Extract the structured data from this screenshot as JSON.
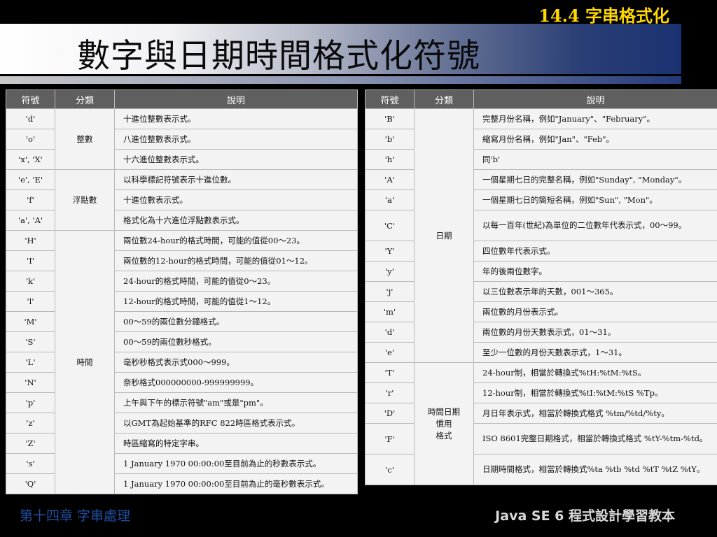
{
  "section": "14.4 字串格式化",
  "title": "數字與日期時間格式化符號",
  "left_table": {
    "headers": [
      "符號",
      "分類",
      "說明"
    ],
    "groups": [
      "整數",
      "浮點數",
      "時間"
    ],
    "rows": [
      {
        "sym": "'d'",
        "desc": "十進位整數表示式。"
      },
      {
        "sym": "'o'",
        "desc": "八進位整數表示式。"
      },
      {
        "sym": "'x', 'X'",
        "desc": "十六進位整數表示式。"
      },
      {
        "sym": "'e', 'E'",
        "desc": "以科學標記符號表示十進位數。"
      },
      {
        "sym": "'f'",
        "desc": "十進位數表示式。"
      },
      {
        "sym": "'a', 'A'",
        "desc": "格式化為十六進位浮點數表示式。"
      },
      {
        "sym": "'H'",
        "desc": "兩位數24-hour的格式時間，可能的值從00～23。"
      },
      {
        "sym": "'I'",
        "desc": "兩位數的12-hour的格式時間，可能的值從01～12。"
      },
      {
        "sym": "'k'",
        "desc": "24-hour的格式時間，可能的值從0～23。"
      },
      {
        "sym": "'l'",
        "desc": "12-hour的格式時間，可能的值從1～12。"
      },
      {
        "sym": "'M'",
        "desc": "00～59的兩位數分鐘格式。"
      },
      {
        "sym": "'S'",
        "desc": "00～59的兩位數秒格式。"
      },
      {
        "sym": "'L'",
        "desc": "毫秒秒格式表示式000～999。"
      },
      {
        "sym": "'N'",
        "desc": "奈秒格式000000000-999999999。"
      },
      {
        "sym": "'p'",
        "desc": "上午與下午的標示符號\"am\"或是\"pm\"。"
      },
      {
        "sym": "'z'",
        "desc": "以GMT為起始基準的RFC 822時區格式表示式。"
      },
      {
        "sym": "'Z'",
        "desc": "時區縮寫的特定字串。"
      },
      {
        "sym": "'s'",
        "desc": "1 January 1970 00:00:00至目前為止的秒數表示式。"
      },
      {
        "sym": "'Q'",
        "desc": "1 January 1970 00:00:00至目前為止的毫秒數表示式。"
      }
    ]
  },
  "right_table": {
    "headers": [
      "符號",
      "分類",
      "說明"
    ],
    "groups": [
      "日期",
      "時間日期\n慣用\n格式"
    ],
    "rows": [
      {
        "sym": "'B'",
        "desc": "完整月份名稱，例如\"January\"、\"February\"。"
      },
      {
        "sym": "'b'",
        "desc": "縮寫月份名稱，例如\"Jan\"、\"Feb\"。"
      },
      {
        "sym": "'h'",
        "desc": "同'b'"
      },
      {
        "sym": "'A'",
        "desc": "一個星期七日的完整名稱，例如\"Sunday\", \"Monday\"。"
      },
      {
        "sym": "'a'",
        "desc": "一個星期七日的簡短名稱，例如\"Sun\", \"Mon\"。"
      },
      {
        "sym": "'C'",
        "desc": "以每一百年(世紀)為單位的二位數年代表示式，00～99。"
      },
      {
        "sym": "'Y'",
        "desc": "四位數年代表示式。"
      },
      {
        "sym": "'y'",
        "desc": "年的後兩位數字。"
      },
      {
        "sym": "'j'",
        "desc": "以三位數表示年的天數，001～365。"
      },
      {
        "sym": "'m'",
        "desc": "兩位數的月份表示式。"
      },
      {
        "sym": "'d'",
        "desc": "兩位數的月份天數表示式，01～31。"
      },
      {
        "sym": "'e'",
        "desc": "至少一位數的月份天數表示式，1～31。"
      },
      {
        "sym": "'T'",
        "desc": "24-hour制，相當於轉換式%tH:%tM:%tS。"
      },
      {
        "sym": "'r'",
        "desc": "12-hour制，相當於轉換式%tI:%tM:%tS %Tp。"
      },
      {
        "sym": "'D'",
        "desc": "月日年表示式，相當於轉換式格式 %tm/%td/%ty。"
      },
      {
        "sym": "'F'",
        "desc": "ISO 8601完整日期格式，相當於轉換式格式 %tY-%tm-%td。"
      },
      {
        "sym": "'c'",
        "desc": "日期時間格式，相當於轉換式%ta %tb %td %tT %tZ %tY。"
      }
    ]
  },
  "footer": {
    "left": "第十四章 字串處理",
    "right": "Java SE 6 程式設計學習教本"
  }
}
